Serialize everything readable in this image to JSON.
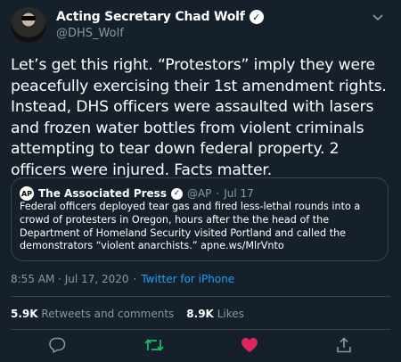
{
  "author": {
    "display_name": "Acting Secretary Chad Wolf",
    "handle": "@DHS_Wolf",
    "verified_glyph": "✓"
  },
  "tweet": {
    "text": "Let’s get this right. “Protestors” imply they were peacefully exercising their 1st amendment rights. Instead, DHS officers were assaulted with lasers and frozen water bottles from violent criminals attempting to tear down federal property. 2 officers were injured. Facts matter."
  },
  "quoted_tweet": {
    "logo_text": "AP",
    "name": "The Associated Press",
    "handle": "@AP",
    "separator": "·",
    "date": "Jul 17",
    "text": "Federal officers deployed tear gas and fired less-lethal rounds into a crowd of protesters in Oregon, hours after the the head of the Department of Homeland Security visited Portland and called the demonstrators “violent anarchists.” apne.ws/MlrVnto"
  },
  "meta": {
    "time": "8:55 AM · Jul 17, 2020",
    "separator": "·",
    "source": "Twitter for iPhone"
  },
  "stats": {
    "retweets_count": "5.9K",
    "retweets_label": "Retweets and comments",
    "likes_count": "8.9K",
    "likes_label": "Likes"
  },
  "actions": {
    "reply_icon": "reply-icon",
    "retweet_icon": "retweet-icon",
    "like_icon": "heart-icon",
    "share_icon": "share-icon"
  },
  "colors": {
    "background": "#15202b",
    "secondary_text": "#8899a6",
    "link": "#1da1f2",
    "border": "#38444d",
    "retweet_green": "#17bf63",
    "like_pink": "#e0245e"
  }
}
